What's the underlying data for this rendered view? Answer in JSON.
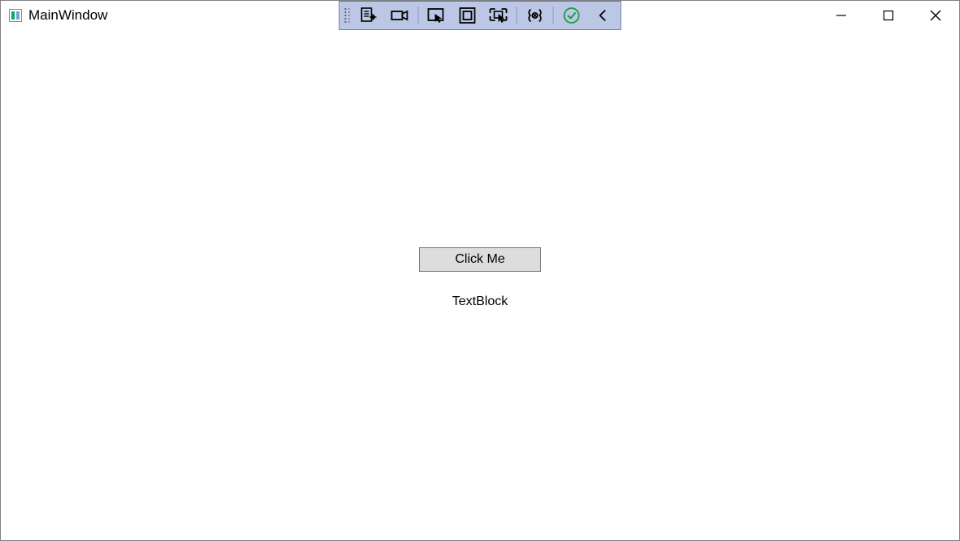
{
  "window": {
    "title": "MainWindow"
  },
  "toolbar": {
    "icons": {
      "visual_tree": "live-visual-tree-icon",
      "recorder": "recorder-icon",
      "select_element": "select-element-icon",
      "layout_adorners": "layout-adorners-icon",
      "track_focused": "track-focused-icon",
      "binding_failures": "binding-failures-icon",
      "hot_reload": "hot-reload-icon",
      "collapse": "collapse-icon"
    }
  },
  "content": {
    "button_label": "Click Me",
    "textblock_label": "TextBlock"
  }
}
